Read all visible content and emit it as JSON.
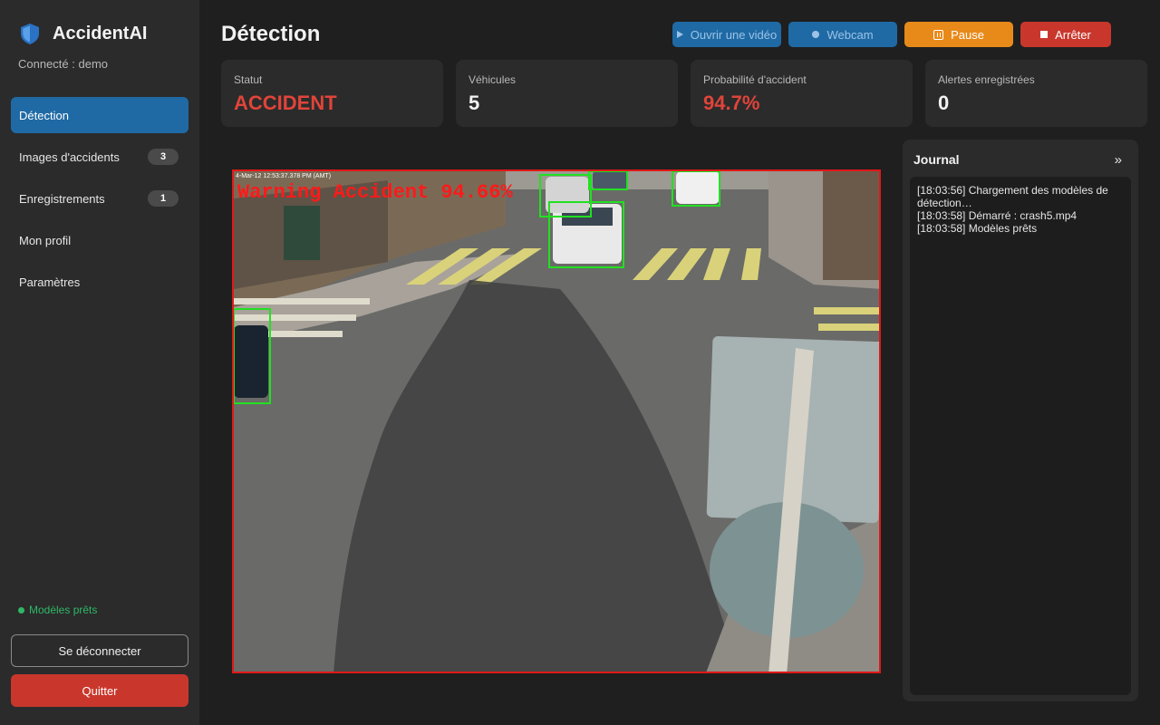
{
  "app": {
    "title": "AccidentAI",
    "connected": "Connecté : demo"
  },
  "sidebar": {
    "items": [
      {
        "label": "Détection",
        "active": true
      },
      {
        "label": "Images d'accidents",
        "badge": "3"
      },
      {
        "label": "Enregistrements",
        "badge": "1"
      },
      {
        "label": "Mon profil"
      },
      {
        "label": "Paramètres"
      }
    ],
    "status": "Modèles prêts",
    "logout_label": "Se déconnecter",
    "quit_label": "Quitter"
  },
  "header": {
    "title": "Détection"
  },
  "toolbar": {
    "open_video": "Ouvrir une vidéo",
    "webcam": "Webcam",
    "pause": "Pause",
    "stop": "Arrêter"
  },
  "cards": [
    {
      "label": "Statut",
      "value": "ACCIDENT",
      "alert": true
    },
    {
      "label": "Véhicules",
      "value": "5"
    },
    {
      "label": "Probabilité d'accident",
      "value": "94.7%",
      "alert": true
    },
    {
      "label": "Alertes enregistrées",
      "value": "0"
    }
  ],
  "video": {
    "overlay_text": "Warning Accident 94.66%",
    "timestamp": "4-Mar-12 12:53:37.378 PM (AMT)",
    "frame_color": "#e01818",
    "box_color": "#22e022"
  },
  "journal": {
    "title": "Journal",
    "toggle": "»",
    "lines": [
      "[18:03:56] Chargement des modèles de détection…",
      "[18:03:58] Démarré : crash5.mp4",
      "[18:03:58] Modèles prêts"
    ]
  },
  "colors": {
    "accent": "#1f6aa5",
    "danger": "#c9372c",
    "warning": "#e88a1a",
    "success": "#2fb766"
  }
}
